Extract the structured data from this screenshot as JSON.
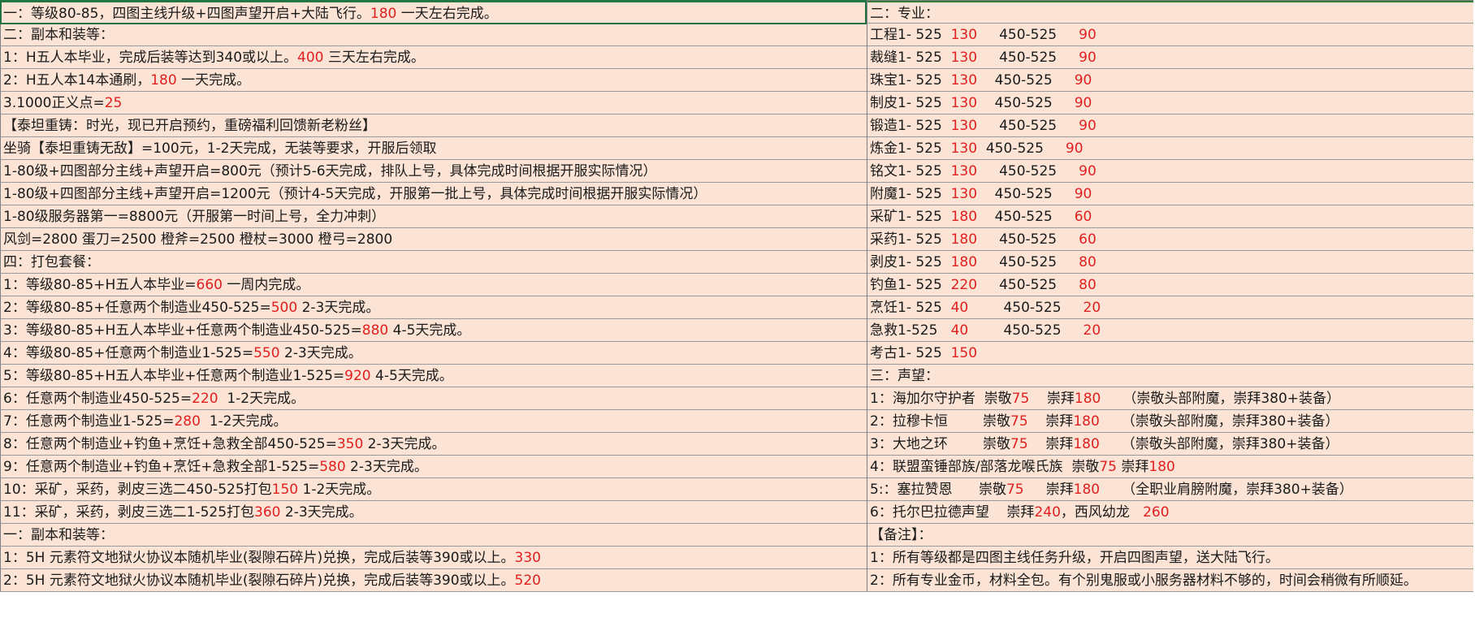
{
  "colors": {
    "highlight": "#e02020",
    "row_bg": "#fbe4d5",
    "grid": "#9a9a9a"
  },
  "left_rows": [
    [
      {
        "t": "一：等级80-85，四图主线升级+四图声望开启+大陆飞行。"
      },
      {
        "t": "180",
        "r": true
      },
      {
        "t": " 一天左右完成。"
      }
    ],
    [
      {
        "t": "二：副本和装等："
      }
    ],
    [
      {
        "t": "1：H五人本毕业，完成后装等达到340或以上。"
      },
      {
        "t": "400",
        "r": true
      },
      {
        "t": " 三天左右完成。"
      }
    ],
    [
      {
        "t": "2：H五人本14本通刷，"
      },
      {
        "t": "180",
        "r": true
      },
      {
        "t": " 一天完成。"
      }
    ],
    [
      {
        "t": "3.1000正义点="
      },
      {
        "t": "25",
        "r": true
      }
    ],
    [
      {
        "t": "【泰坦重铸：时光，现已开启预约，重磅福利回馈新老粉丝】"
      }
    ],
    [
      {
        "t": "坐骑【泰坦重铸无敌】=100元，1-2天完成，无装等要求，开服后领取"
      }
    ],
    [
      {
        "t": "1-80级+四图部分主线+声望开启=800元（预计5-6天完成，排队上号，具体完成时间根据开服实际情况）"
      }
    ],
    [
      {
        "t": "1-80级+四图部分主线+声望开启=1200元（预计4-5天完成，开服第一批上号，具体完成时间根据开服实际情况）"
      }
    ],
    [
      {
        "t": "1-80级服务器第一=8800元（开服第一时间上号，全力冲刺）"
      }
    ],
    [
      {
        "t": "风剑=2800 蛋刀=2500 橙斧=2500 橙杖=3000 橙弓=2800"
      }
    ],
    [
      {
        "t": "四：打包套餐："
      }
    ],
    [
      {
        "t": "1：等级80-85+H五人本毕业="
      },
      {
        "t": "660",
        "r": true
      },
      {
        "t": " 一周内完成。"
      }
    ],
    [
      {
        "t": "2：等级80-85+任意两个制造业450-525="
      },
      {
        "t": "500",
        "r": true
      },
      {
        "t": " 2-3天完成。"
      }
    ],
    [
      {
        "t": "3：等级80-85+H五人本毕业+任意两个制造业450-525="
      },
      {
        "t": "880",
        "r": true
      },
      {
        "t": " 4-5天完成。"
      }
    ],
    [
      {
        "t": "4：等级80-85+任意两个制造业1-525="
      },
      {
        "t": "550",
        "r": true
      },
      {
        "t": " 2-3天完成。"
      }
    ],
    [
      {
        "t": "5：等级80-85+H五人本毕业+任意两个制造业1-525="
      },
      {
        "t": "920",
        "r": true
      },
      {
        "t": " 4-5天完成。"
      }
    ],
    [
      {
        "t": "6：任意两个制造业450-525="
      },
      {
        "t": "220",
        "r": true
      },
      {
        "t": "  1-2天完成。"
      }
    ],
    [
      {
        "t": "7：任意两个制造业1-525="
      },
      {
        "t": "280",
        "r": true
      },
      {
        "t": "  1-2天完成。"
      }
    ],
    [
      {
        "t": "8：任意两个制造业+钓鱼+烹饪+急救全部450-525="
      },
      {
        "t": "350",
        "r": true
      },
      {
        "t": " 2-3天完成。"
      }
    ],
    [
      {
        "t": "9：任意两个制造业+钓鱼+烹饪+急救全部1-525="
      },
      {
        "t": "580",
        "r": true
      },
      {
        "t": " 2-3天完成。"
      }
    ],
    [
      {
        "t": "10：采矿，采药，剥皮三选二450-525打包"
      },
      {
        "t": "150",
        "r": true
      },
      {
        "t": " 1-2天完成。"
      }
    ],
    [
      {
        "t": "11：采矿，采药，剥皮三选二1-525打包"
      },
      {
        "t": "360",
        "r": true
      },
      {
        "t": " 2-3天完成。"
      }
    ],
    [
      {
        "t": "一：副本和装等："
      }
    ],
    [
      {
        "t": "1：5H 元素符文地狱火协议本随机毕业(裂隙石碎片)兑换，完成后装等390或以上。"
      },
      {
        "t": "330",
        "r": true
      }
    ],
    [
      {
        "t": "2：5H 元素符文地狱火协议本随机毕业(裂隙石碎片)兑换，完成后装等390或以上。"
      },
      {
        "t": "520",
        "r": true
      }
    ]
  ],
  "right_rows": [
    [
      {
        "t": "二：专业："
      }
    ],
    [
      {
        "t": "工程1- 525  "
      },
      {
        "t": "130",
        "r": true
      },
      {
        "t": "     450-525     "
      },
      {
        "t": "90",
        "r": true
      }
    ],
    [
      {
        "t": "裁缝1- 525  "
      },
      {
        "t": "130",
        "r": true
      },
      {
        "t": "     450-525     "
      },
      {
        "t": "90",
        "r": true
      }
    ],
    [
      {
        "t": "珠宝1- 525  "
      },
      {
        "t": "130",
        "r": true
      },
      {
        "t": "    450-525     "
      },
      {
        "t": "90",
        "r": true
      }
    ],
    [
      {
        "t": "制皮1- 525  "
      },
      {
        "t": "130",
        "r": true
      },
      {
        "t": "    450-525     "
      },
      {
        "t": "90",
        "r": true
      }
    ],
    [
      {
        "t": "锻造1- 525  "
      },
      {
        "t": "130",
        "r": true
      },
      {
        "t": "     450-525     "
      },
      {
        "t": "90",
        "r": true
      }
    ],
    [
      {
        "t": "炼金1- 525  "
      },
      {
        "t": "130",
        "r": true
      },
      {
        "t": "  450-525     "
      },
      {
        "t": "90",
        "r": true
      }
    ],
    [
      {
        "t": "铭文1- 525  "
      },
      {
        "t": "130",
        "r": true
      },
      {
        "t": "     450-525     "
      },
      {
        "t": "90",
        "r": true
      }
    ],
    [
      {
        "t": "附魔1- 525  "
      },
      {
        "t": "130",
        "r": true
      },
      {
        "t": "    450-525     "
      },
      {
        "t": "90",
        "r": true
      }
    ],
    [
      {
        "t": "采矿1- 525  "
      },
      {
        "t": "180",
        "r": true
      },
      {
        "t": "    450-525     "
      },
      {
        "t": "60",
        "r": true
      }
    ],
    [
      {
        "t": "采药1- 525  "
      },
      {
        "t": "180",
        "r": true
      },
      {
        "t": "     450-525     "
      },
      {
        "t": "60",
        "r": true
      }
    ],
    [
      {
        "t": "剥皮1- 525  "
      },
      {
        "t": "180",
        "r": true
      },
      {
        "t": "     450-525     "
      },
      {
        "t": "80",
        "r": true
      }
    ],
    [
      {
        "t": "钓鱼1- 525  "
      },
      {
        "t": "220",
        "r": true
      },
      {
        "t": "     450-525     "
      },
      {
        "t": "80",
        "r": true
      }
    ],
    [
      {
        "t": "烹饪1- 525  "
      },
      {
        "t": "40",
        "r": true
      },
      {
        "t": "        450-525     "
      },
      {
        "t": "20",
        "r": true
      }
    ],
    [
      {
        "t": "急救1-525   "
      },
      {
        "t": "40",
        "r": true
      },
      {
        "t": "        450-525     "
      },
      {
        "t": "20",
        "r": true
      }
    ],
    [
      {
        "t": "考古1- 525  "
      },
      {
        "t": "150",
        "r": true
      }
    ],
    [
      {
        "t": "三：声望："
      }
    ],
    [
      {
        "t": "1：海加尔守护者  崇敬"
      },
      {
        "t": "75",
        "r": true
      },
      {
        "t": "    崇拜"
      },
      {
        "t": "180",
        "r": true
      },
      {
        "t": "     （崇敬头部附魔，崇拜380+装备）"
      }
    ],
    [
      {
        "t": "2：拉穆卡恒        崇敬"
      },
      {
        "t": "75",
        "r": true
      },
      {
        "t": "    崇拜"
      },
      {
        "t": "180",
        "r": true
      },
      {
        "t": "     （崇敬头部附魔，崇拜380+装备）"
      }
    ],
    [
      {
        "t": "3：大地之环        崇敬"
      },
      {
        "t": "75",
        "r": true
      },
      {
        "t": "    崇拜"
      },
      {
        "t": "180",
        "r": true
      },
      {
        "t": "     （崇敬头部附魔，崇拜380+装备）"
      }
    ],
    [
      {
        "t": "4：联盟蛮锤部族/部落龙喉氏族  崇敬"
      },
      {
        "t": "75",
        "r": true
      },
      {
        "t": " 崇拜"
      },
      {
        "t": "180",
        "r": true
      }
    ],
    [
      {
        "t": "5:：塞拉赞恩      崇敬"
      },
      {
        "t": "75",
        "r": true
      },
      {
        "t": "     崇拜"
      },
      {
        "t": "180",
        "r": true
      },
      {
        "t": "     （全职业肩膀附魔，崇拜380+装备）"
      }
    ],
    [
      {
        "t": "6：托尔巴拉德声望    崇拜"
      },
      {
        "t": "240",
        "r": true
      },
      {
        "t": "，西风幼龙   "
      },
      {
        "t": "260",
        "r": true
      }
    ],
    [
      {
        "t": "【备注】："
      }
    ],
    [
      {
        "t": "1：所有等级都是四图主线任务升级，开启四图声望，送大陆飞行。"
      }
    ],
    [
      {
        "t": "2：所有专业金币，材料全包。有个别鬼服或小服务器材料不够的，时间会稍微有所顺延。"
      }
    ]
  ]
}
